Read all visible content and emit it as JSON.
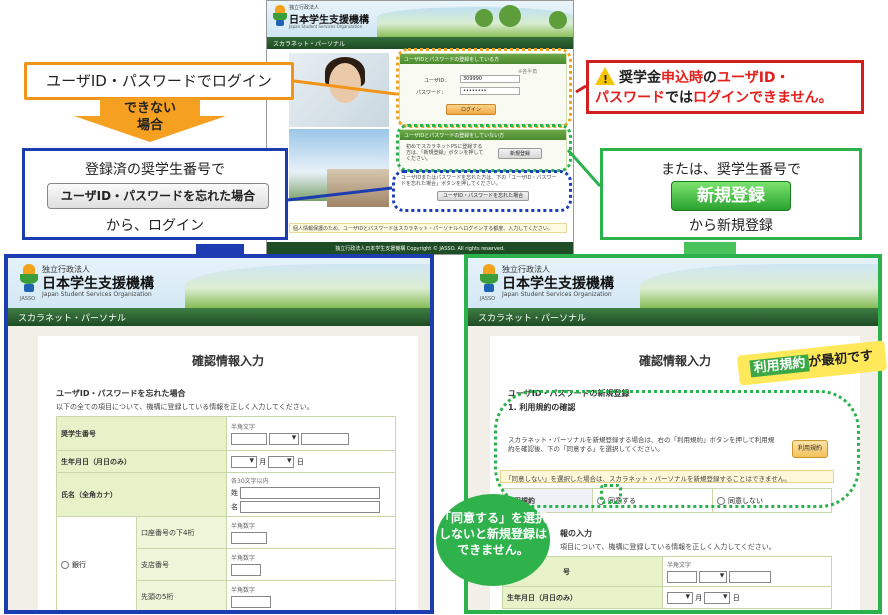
{
  "top_screen": {
    "org_small": "独立行政法人",
    "org_name": "日本学生支援機構",
    "org_en": "Japan Student Services Organization",
    "jasso": "JASSO",
    "nav_title": "スカラネット・パーソナル",
    "login_box_head": "ユーザIDとパスワードの登録をしている方",
    "required_note": "※各半角",
    "user_id_label": "ユーザID：",
    "user_id_value": "309990",
    "password_label": "パスワード：",
    "password_value": "••••••••",
    "login_button": "ログイン",
    "new_box_head": "ユーザIDとパスワードの登録をしていない方",
    "new_box_text": "初めてスカラネットPSに登録する方は、「新規登録」ボタンを押してください。",
    "new_button": "新規登録",
    "forgot_text": "ユーザIDまたはパスワードを忘れた方は、下の「ユーザID・パスワードを忘れた場合」ボタンを押してください。",
    "forgot_button": "ユーザID・パスワードを忘れた場合",
    "notice": "個人情報保護のため、ユーザIDとパスワードはスカラネット・パーソナルへログインする都度、入力してください。",
    "footer": "独立行政法人日本学生支援機構 Copyright © JASSO. All rights reserved."
  },
  "callouts": {
    "login": "ユーザID・パスワードでログイン",
    "cannot_1": "できない",
    "cannot_2": "場合",
    "registered_number": "登録済の奨学生番号で",
    "forgot_button": "ユーザID・パスワードを忘れた場合",
    "from_login": "から、ログイン",
    "warning_part1": "奨学金",
    "warning_part2": "申込時",
    "warning_part3": "の",
    "warning_part4": "ユーザID・",
    "warning_part5": "パスワード",
    "warning_part6": "では",
    "warning_part7": "ログインできません。",
    "or_number": "または、奨学生番号で",
    "new_register": "新規登録",
    "from_new": "から新規登録",
    "rules_badge_hl": "利用規約",
    "rules_badge_rest": "が最初です",
    "bubble": "「同意する」を選択しないと新規登録はできません。"
  },
  "left_panel": {
    "org_small": "独立行政法人",
    "org_name": "日本学生支援機構",
    "org_en": "Japan Student Services Organization",
    "jasso": "JASSO",
    "nav_title": "スカラネット・パーソナル",
    "page_title": "確認情報入力",
    "section": "ユーザID・パスワードを忘れた場合",
    "instruction": "以下の全ての項目について、機構に登録している情報を正しく入力してください。",
    "rows": {
      "student_number": "奨学生番号",
      "birth": "生年月日（月日のみ）",
      "name": "氏名（全角カナ）",
      "bank": "銀行",
      "account_last4": "口座番号の下4桁",
      "branch": "支店番号",
      "head5": "先頭の5桁"
    },
    "hints": {
      "halfwidth_alpha": "半角文字",
      "fullwidth30": "各30文字以内",
      "halfwidth_num": "半角数字"
    },
    "month": "月",
    "day": "日",
    "sei": "姓",
    "mei": "名"
  },
  "right_panel": {
    "org_small": "独立行政法人",
    "org_name": "日本学生支援機構",
    "org_en": "Japan Student Services Organization",
    "jasso": "JASSO",
    "nav_title": "スカラネット・パーソナル",
    "page_title": "確認情報入力",
    "section": "ユーザID・パスワードの新規登録",
    "subsection": "1. 利用規約の確認",
    "rules_text": "スカラネット・パーソナルを新規登録する場合は、右の「利用規約」ボタンを押して利用規約を確認後、下の「同意する」を選択してください。",
    "rules_button": "利用規約",
    "disagree_warning": "「同意しない」を選択した場合は、スカラネット・パーソナルを新規登録することはできません。",
    "rules_label": "利用規約",
    "agree": "同意する",
    "disagree": "同意しない",
    "section2": "報の入力",
    "instruction2": "項目について、機構に登録している情報を正しく入力してください。",
    "student_number_short": "号",
    "birth": "生年月日（月日のみ）",
    "halfwidth_alpha": "半角文字",
    "month": "月",
    "day": "日"
  }
}
